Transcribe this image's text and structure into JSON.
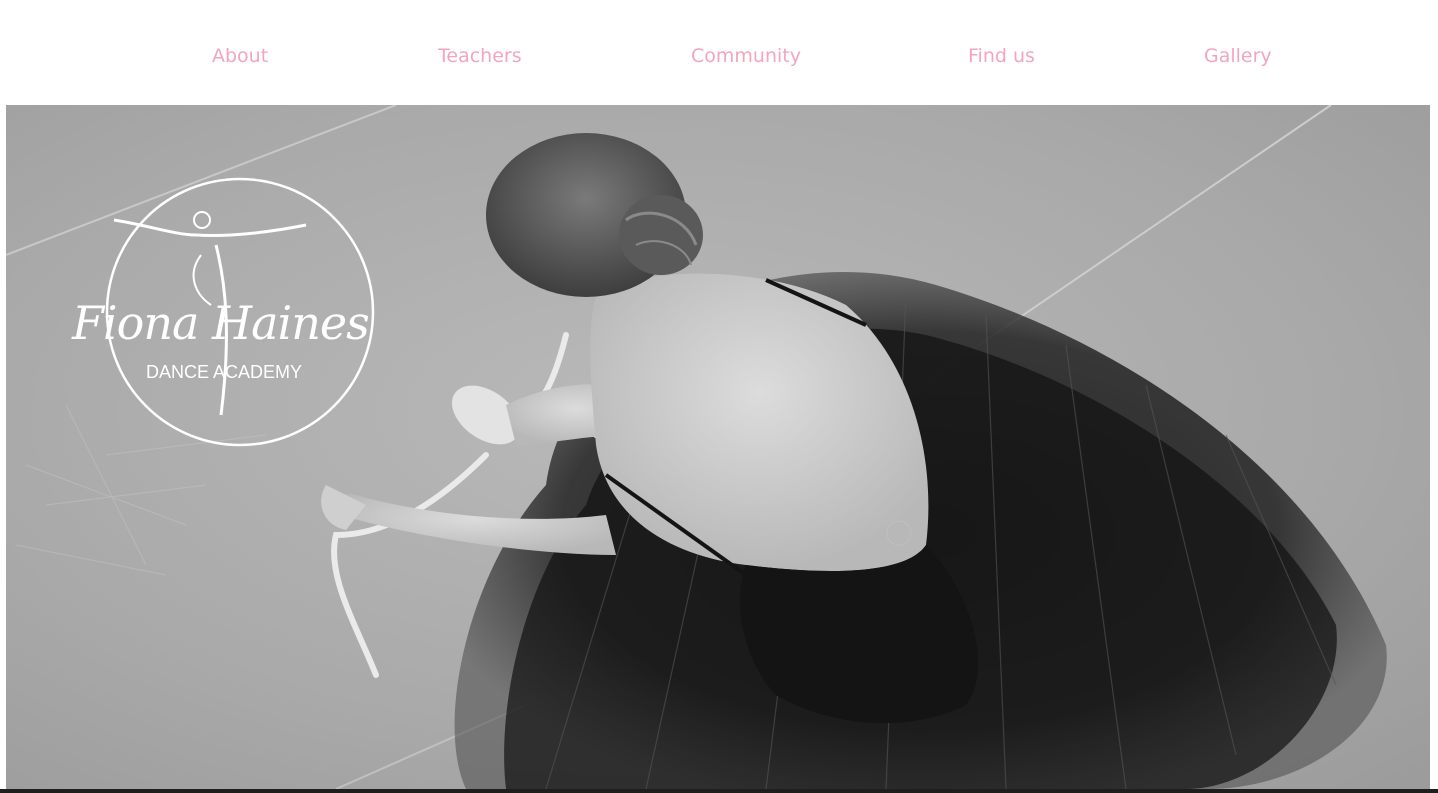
{
  "nav": {
    "items": [
      {
        "label": "About"
      },
      {
        "label": "Teachers"
      },
      {
        "label": "Community"
      },
      {
        "label": "Find us"
      },
      {
        "label": "Gallery"
      }
    ],
    "link_color": "#f2a6bd"
  },
  "hero": {
    "logo": {
      "script_text": "Fiona Haines",
      "subtitle": "DANCE ACADEMY"
    },
    "image_tone": "grayscale",
    "subject": "ballet-dancer-tying-pointe-shoe"
  }
}
